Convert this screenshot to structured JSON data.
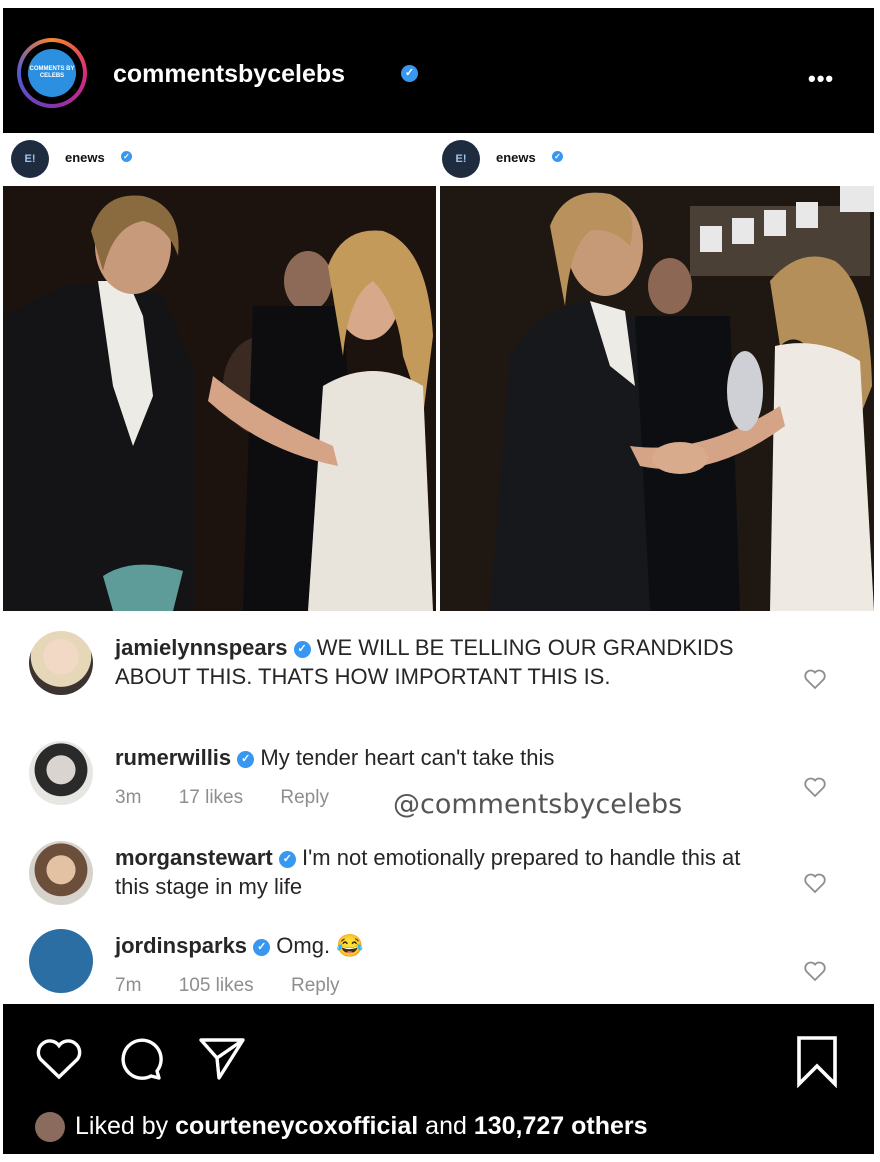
{
  "header": {
    "username": "commentsbycelebs",
    "avatar_text": "COMMENTS BY CELEBS",
    "more_label": "•••"
  },
  "embed": {
    "left": {
      "username": "enews",
      "avatar_text": "E!"
    },
    "right": {
      "username": "enews",
      "avatar_text": "E!"
    }
  },
  "comments": [
    {
      "username": "jamielynnspears",
      "text": "WE WILL BE TELLING OUR GRANDKIDS ABOUT THIS. THATS HOW IMPORTANT THIS IS."
    },
    {
      "username": "rumerwillis",
      "text": "My tender heart can't take this",
      "time": "3m",
      "likes": "17 likes",
      "reply": "Reply"
    },
    {
      "username": "morganstewart",
      "text": "I'm not emotionally prepared to handle this at this stage in my life"
    },
    {
      "username": "jordinsparks",
      "text": "Omg. 😂",
      "time": "7m",
      "likes": "105 likes",
      "reply": "Reply",
      "avatar_color": "#2b6ea4"
    }
  ],
  "watermark": "@commentsbycelebs",
  "footer": {
    "liked_prefix": "Liked by",
    "liked_user": "courteneycoxofficial",
    "liked_and": "and",
    "liked_count": "130,727 others"
  },
  "colors": {
    "verified": "#3897f0",
    "background_dark": "#000000",
    "meta_gray": "#8e8e8e"
  },
  "icons": [
    "more-icon",
    "heart-icon",
    "comment-icon",
    "share-icon",
    "bookmark-icon",
    "verified-icon"
  ]
}
